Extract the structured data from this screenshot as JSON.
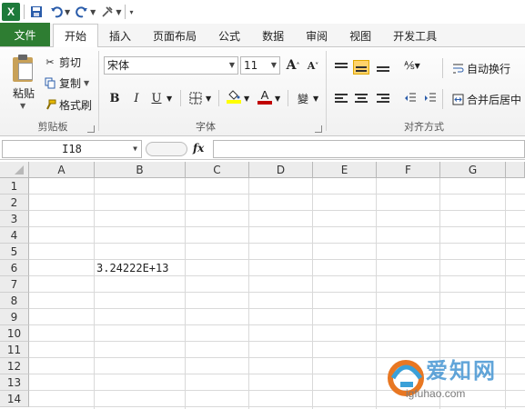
{
  "quick_access": {
    "app_icon_letter": "X"
  },
  "tabs": [
    "文件",
    "开始",
    "插入",
    "页面布局",
    "公式",
    "数据",
    "审阅",
    "视图",
    "开发工具"
  ],
  "ribbon": {
    "clipboard": {
      "paste": "粘贴",
      "cut": "剪切",
      "copy": "复制",
      "format_painter": "格式刷",
      "group_label": "剪贴板"
    },
    "font": {
      "font_name": "宋体",
      "font_size": "11",
      "bold": "B",
      "italic": "I",
      "underline": "U",
      "grow": "A",
      "shrink": "A",
      "font_color_letter": "A",
      "phonetic": "變",
      "group_label": "字体"
    },
    "alignment": {
      "wrap_text": "自动换行",
      "merge_center": "合并后居中",
      "group_label": "对齐方式"
    }
  },
  "formula_bar": {
    "name_box": "I18",
    "fx": "fx",
    "formula": ""
  },
  "sheet": {
    "columns": [
      "A",
      "B",
      "C",
      "D",
      "E",
      "F",
      "G"
    ],
    "rows": [
      "1",
      "2",
      "3",
      "4",
      "5",
      "6",
      "7",
      "8",
      "9",
      "10",
      "11",
      "12",
      "13",
      "14"
    ],
    "cells": {
      "B6": "3.24222E+13"
    }
  },
  "watermark": {
    "line1": "爱知网",
    "line2": "igfuhao.com"
  },
  "colors": {
    "file_tab": "#2e7d32",
    "selected_align": "#ffd36b",
    "font_color_bar": "#c00000",
    "fill_color_bar": "#ffff00"
  }
}
